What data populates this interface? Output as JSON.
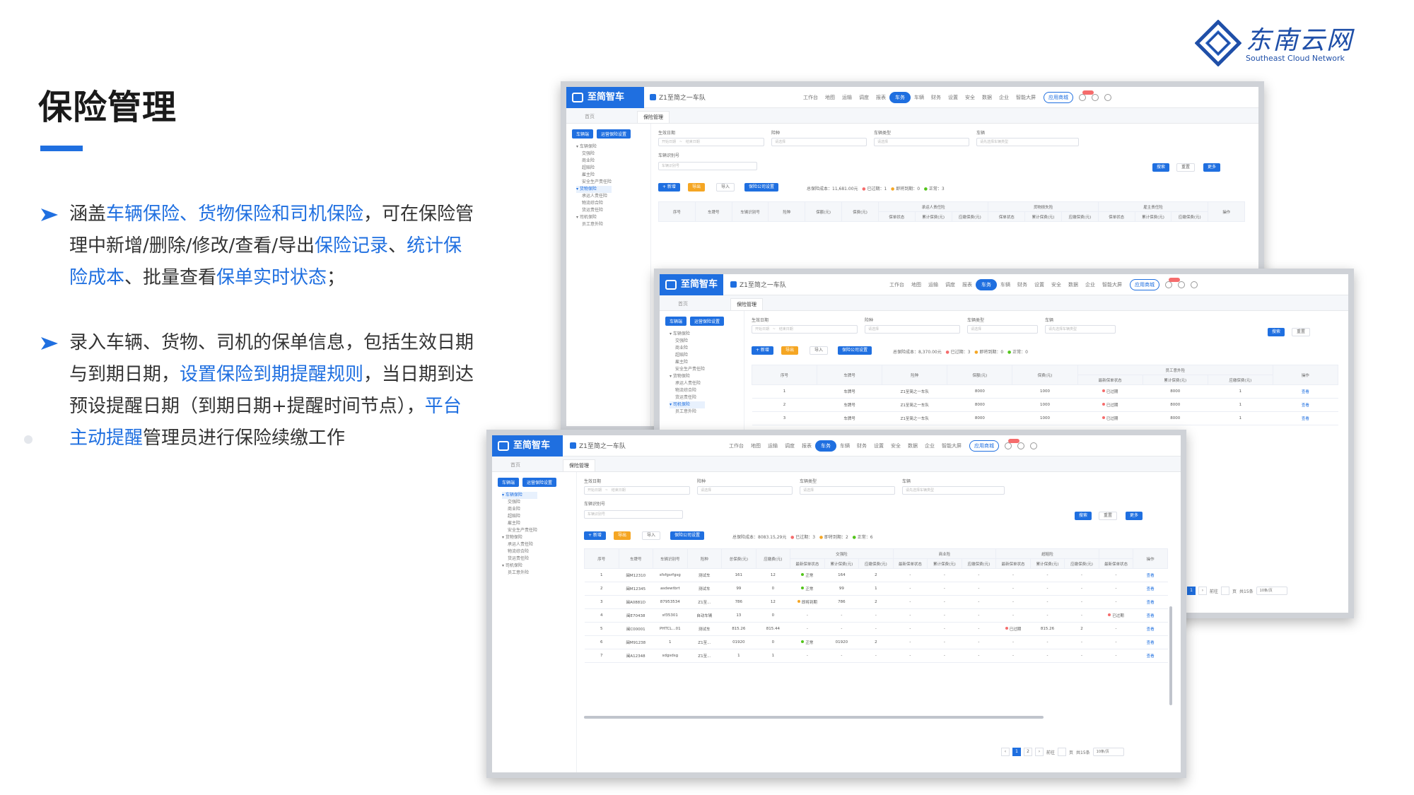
{
  "slide": {
    "title": "保险管理",
    "bullets": [
      {
        "parts": [
          {
            "t": "涵盖",
            "hl": false
          },
          {
            "t": "车辆保险、货物保险和司机保险",
            "hl": true
          },
          {
            "t": "，可在保险管理中新增/删除/修改/查看/导出",
            "hl": false
          },
          {
            "t": "保险记录",
            "hl": true
          },
          {
            "t": "、",
            "hl": false
          },
          {
            "t": "统计保险成本",
            "hl": true
          },
          {
            "t": "、批量查看",
            "hl": false
          },
          {
            "t": "保单实时状态",
            "hl": true
          },
          {
            "t": "；",
            "hl": false
          }
        ]
      },
      {
        "parts": [
          {
            "t": "录入车辆、货物、司机的保单信息，包括生效日期与到期日期，",
            "hl": false
          },
          {
            "t": "设置保险到期提醒规则",
            "hl": true
          },
          {
            "t": "，当日期到达预设提醒日期（到期日期+提醒时间节点），",
            "hl": false
          },
          {
            "t": "平台主动提醒",
            "hl": true
          },
          {
            "t": "管理员进行保险续缴工作",
            "hl": false
          }
        ]
      }
    ],
    "accent_color": "#1f6fe0"
  },
  "logo": {
    "name": "东南云网",
    "subtitle": "Southeast Cloud Network"
  },
  "app": {
    "brand": "至简智车",
    "team": "Z1至简之一车队",
    "nav": [
      "工作台",
      "地图",
      "运输",
      "调度",
      "报表",
      "车辆",
      "财务",
      "设置",
      "安全",
      "数据",
      "企业",
      "智能大屏"
    ],
    "nav_active": "车务",
    "nav_app": "应用商城",
    "tabs": [
      "首页",
      "保险管理"
    ],
    "side_buttons": [
      "车辆端",
      "运营保险设置"
    ],
    "tree_a": [
      "车辆保险",
      "交强险",
      "商业险",
      "超赔险",
      "雇主险",
      "安全生产责任险",
      "货物保险",
      "承运人责任险",
      "物流综合险",
      "货运责任险",
      "司机保险",
      "员工意外险"
    ],
    "tree_c": [
      "车辆保险",
      "交强险",
      "商业险",
      "超赔险",
      "雇主险",
      "安全生产责任险",
      "货物保险",
      "承运人责任险",
      "物流综合险",
      "货运责任险",
      "司机保险",
      "员工意外险"
    ],
    "filters": {
      "date_label": "生效日期",
      "date_start": "开始日期",
      "date_sep": "~",
      "date_end": "结束日期",
      "type_label": "险种",
      "type_ph": "请选择",
      "vtype_label": "车辆类型",
      "vtype_ph": "请选择",
      "vehicle_label": "车辆",
      "vehicle_ph": "请先选择车辆类型",
      "plate_label": "车辆识别号",
      "plate_ph": "车辆识别号"
    },
    "buttons": {
      "search": "搜索",
      "reset": "重置",
      "more": "更多",
      "add": "+ 新增",
      "export": "导出",
      "import": "导入",
      "company": "保险公司设置"
    },
    "stats_a": {
      "cost": "总保险成本：11,681.00元",
      "expired": "已过期：1",
      "expiring": "即将到期：0",
      "normal": "正常：3"
    },
    "stats_b": {
      "cost": "总保险成本：8,370.00元",
      "expired": "已过期：3",
      "expiring": "即将到期：0",
      "normal": "正常：0"
    },
    "stats_c": {
      "cost": "总保险成本：8083.15,29元",
      "expired": "已过期：3",
      "expiring": "即将到期：2",
      "normal": "正常：6"
    },
    "headers_a": [
      "序号",
      "车牌号",
      "车辆识别号",
      "险种",
      "保额(元)",
      "保费(元)",
      "承运人责任险",
      "货物损失险",
      "雇主责任险",
      "操作"
    ],
    "headers_a_sub": [
      "保单状态",
      "累计保费(元)",
      "应缴保费(元)",
      "保单状态",
      "累计保费(元)",
      "应缴保费(元)",
      "保单状态",
      "累计保费(元)",
      "应缴保费(元)"
    ],
    "headers_b": [
      "序号",
      "车牌号",
      "险种",
      "保额(元)",
      "保费(元)",
      "员工意外险",
      "操作"
    ],
    "headers_b_sub": [
      "最新保单状态",
      "累计保费(元)",
      "应缴保费(元)"
    ],
    "rows_b": [
      [
        "1",
        "车牌号",
        "Z1至简之一车队",
        "8000",
        "1000",
        "已过期",
        "8000",
        "1",
        "查看"
      ],
      [
        "2",
        "车牌号",
        "Z1至简之一车队",
        "8000",
        "1000",
        "已过期",
        "8000",
        "1",
        "查看"
      ],
      [
        "3",
        "车牌号",
        "Z1至简之一车队",
        "8000",
        "1000",
        "已过期",
        "8000",
        "1",
        "查看"
      ]
    ],
    "headers_c_groups": [
      "交强险",
      "商业险",
      "超赔险"
    ],
    "headers_c": [
      "序号",
      "车牌号",
      "车辆识别号",
      "险种",
      "总保费(元)",
      "应缴费(元)",
      "最新保单状态",
      "累计保费(元)",
      "应缴保费(元)",
      "最新保单状态",
      "累计保费(元)",
      "应缴保费(元)",
      "最新保单状态",
      "累计保费(元)",
      "应缴保费(元)",
      "最新保单状态",
      "操作"
    ],
    "rows_c": [
      [
        "1",
        "闽M12310",
        "sfsfgsrfgsg",
        "测试车",
        "161",
        "12",
        "正常",
        "164",
        "2",
        "-",
        "-",
        "-",
        "-",
        "-",
        "-",
        "-",
        "查看"
      ],
      [
        "2",
        "闽M12345",
        "asdewtbrt",
        "测试车",
        "99",
        "0",
        "正常",
        "99",
        "1",
        "-",
        "-",
        "-",
        "-",
        "-",
        "-",
        "-",
        "查看"
      ],
      [
        "3",
        "闽A0881D",
        "87953534",
        "Z1至...",
        "786",
        "12",
        "即将到期",
        "786",
        "2",
        "-",
        "-",
        "-",
        "-",
        "-",
        "-",
        "-",
        "查看"
      ],
      [
        "4",
        "闽E70438",
        "sf35301",
        "自动车辆",
        "13",
        "0",
        "-",
        "-",
        "-",
        "-",
        "-",
        "-",
        "-",
        "-",
        "-",
        "已过期",
        "查看"
      ],
      [
        "5",
        "闽C00001",
        "PHTCL...01",
        "测试车",
        "815.26",
        "815.44",
        "-",
        "-",
        "-",
        "-",
        "-",
        "-",
        "已过期",
        "815.26",
        "2",
        "-",
        "查看"
      ],
      [
        "6",
        "闽M91238",
        "1",
        "Z1至...",
        "01920",
        "0",
        "正常",
        "01920",
        "2",
        "-",
        "-",
        "-",
        "-",
        "-",
        "-",
        "-",
        "查看"
      ],
      [
        "7",
        "闽A12348",
        "sdgsdsg",
        "Z1至...",
        "1",
        "1",
        "-",
        "-",
        "-",
        "-",
        "-",
        "-",
        "-",
        "-",
        "-",
        "-",
        "查看"
      ]
    ],
    "pager": {
      "pages": [
        "1"
      ],
      "goto": "前往",
      "page_unit": "页",
      "total": "共15条",
      "size": "10条/页"
    }
  }
}
